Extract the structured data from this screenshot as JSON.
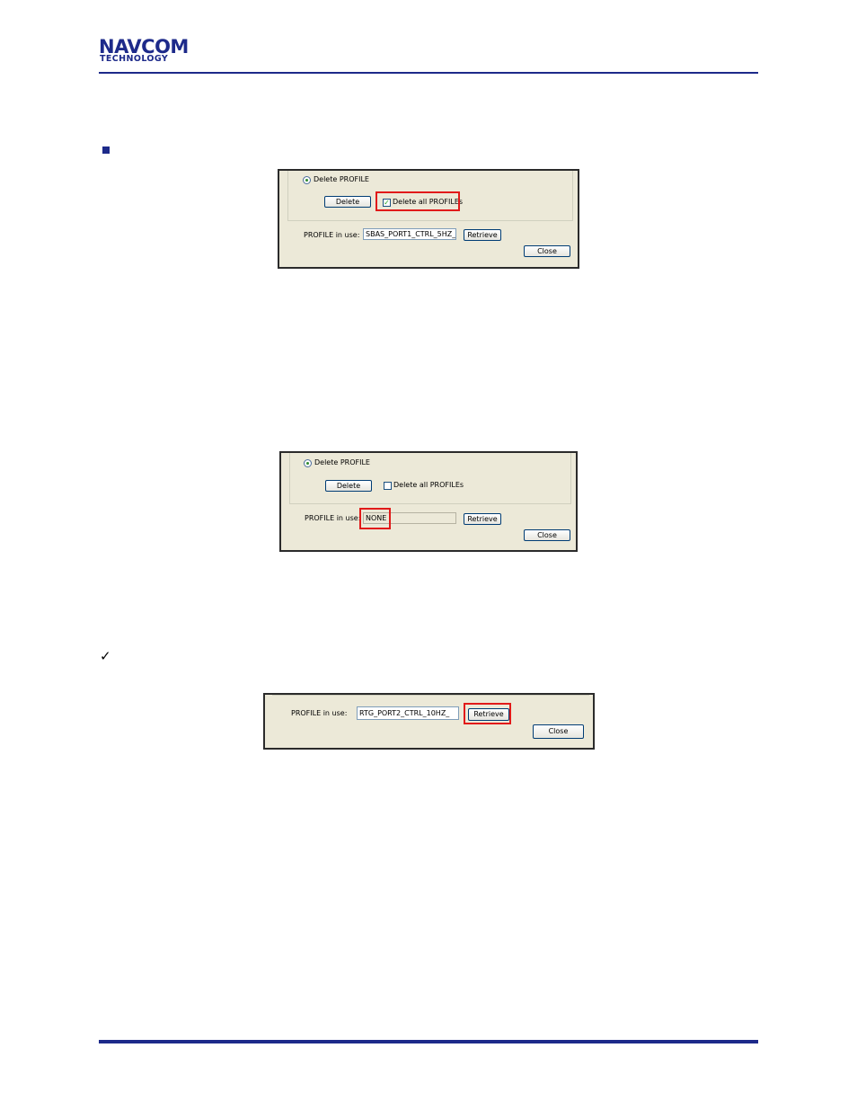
{
  "header": {
    "logo_line1": "NAVCOM",
    "logo_line2": "TECHNOLOGY"
  },
  "bullets": {
    "square_icon": "square-bullet",
    "check_icon": "✓"
  },
  "dialog1": {
    "radio_label": "Delete PROFILE",
    "delete_button": "Delete",
    "delete_all_label": "Delete all PROFILEs",
    "delete_all_checked": "✓",
    "profile_label": "PROFILE in use:",
    "profile_value": "SBAS_PORT1_CTRL_5HZ_",
    "retrieve_button": "Retrieve",
    "close_button": "Close"
  },
  "dialog2": {
    "radio_label": "Delete PROFILE",
    "delete_button": "Delete",
    "delete_all_label": "Delete all PROFILEs",
    "profile_label": "PROFILE in use:",
    "profile_value": "NONE",
    "retrieve_button": "Retrieve",
    "close_button": "Close"
  },
  "dialog3": {
    "profile_label": "PROFILE in use:",
    "profile_value": "RTG_PORT2_CTRL_10HZ_",
    "retrieve_button": "Retrieve",
    "close_button": "Close"
  },
  "colors": {
    "brand": "#1d2a8a",
    "highlight": "#e11a1a"
  }
}
